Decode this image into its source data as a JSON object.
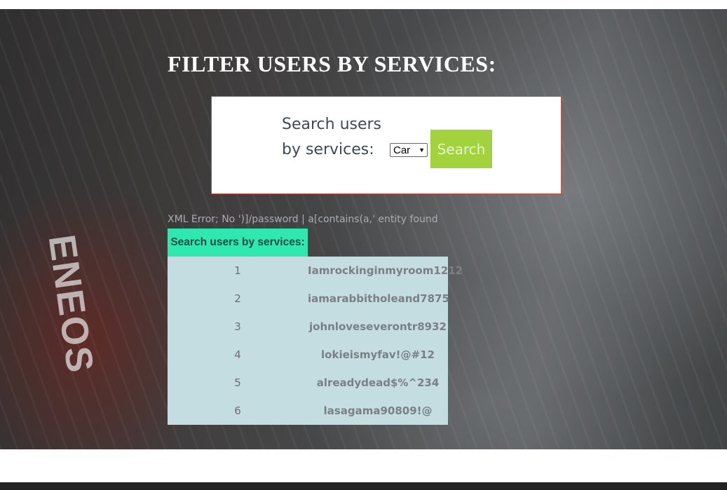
{
  "hero": {
    "brand_mark": "ENEOS",
    "title": "FILTER USERS BY SERVICES:"
  },
  "search": {
    "label": "Search users by services:",
    "selected_service": "Car",
    "button_label": "Search"
  },
  "error_message": "XML Error; No ')]/password | a[contains(a,' entity found",
  "results": {
    "header": "Search users by services:",
    "rows": [
      {
        "index": "1",
        "value": "Iamrockinginmyroom1212"
      },
      {
        "index": "2",
        "value": "iamarabbitholeand7875"
      },
      {
        "index": "3",
        "value": "johnloveseverontr8932"
      },
      {
        "index": "4",
        "value": "lokieismyfav!@#12"
      },
      {
        "index": "5",
        "value": "alreadydead$%^234"
      },
      {
        "index": "6",
        "value": "lasagama90809!@"
      }
    ]
  },
  "colors": {
    "accent_button": "#a2d23c",
    "results_header": "#2ee8b0",
    "table_background": "#c3dde0",
    "panel_border": "#cc4b3c"
  }
}
